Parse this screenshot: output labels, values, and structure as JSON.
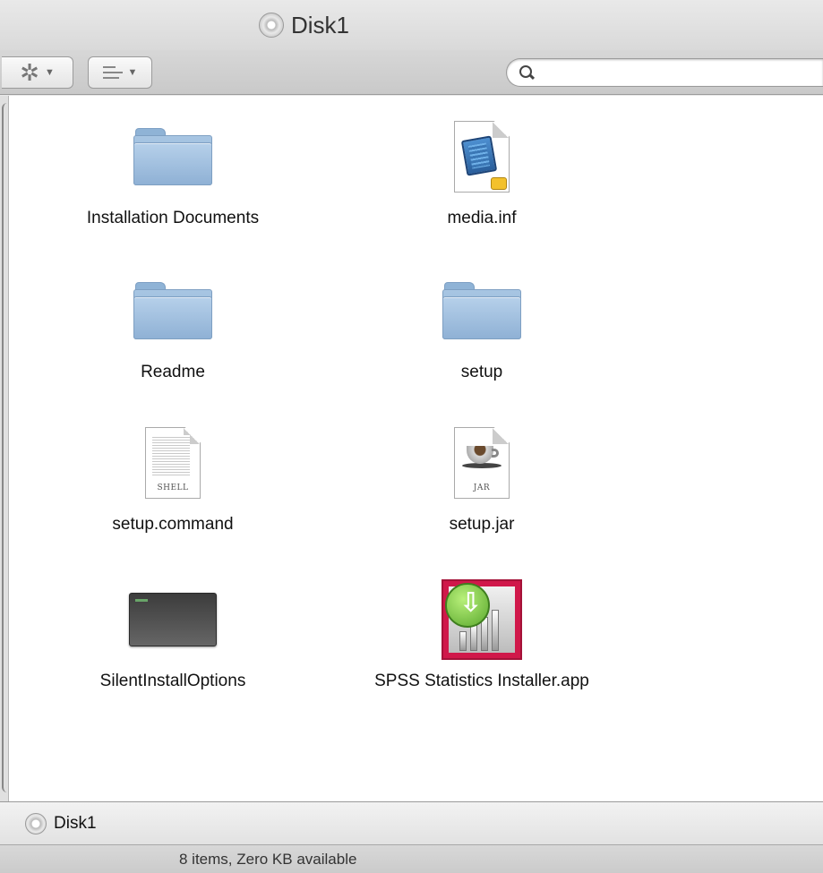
{
  "window": {
    "title": "Disk1",
    "title_icon": "disc-icon"
  },
  "toolbar": {
    "action_icon": "gear-icon",
    "arrange_icon": "arrange-lines-icon",
    "search_placeholder": "",
    "search_value": ""
  },
  "items": [
    {
      "name": "Installation Documents",
      "kind": "folder"
    },
    {
      "name": "media.inf",
      "kind": "document"
    },
    {
      "name": "Readme",
      "kind": "folder"
    },
    {
      "name": "setup",
      "kind": "folder"
    },
    {
      "name": "setup.command",
      "kind": "shell",
      "tag": "SHELL"
    },
    {
      "name": "setup.jar",
      "kind": "jar",
      "tag": "JAR"
    },
    {
      "name": "SilentInstallOptions",
      "kind": "terminal-doc"
    },
    {
      "name": "SPSS Statistics Installer.app",
      "kind": "app"
    }
  ],
  "pathbar": {
    "label": "Disk1"
  },
  "status": {
    "text": "8 items, Zero KB available"
  }
}
